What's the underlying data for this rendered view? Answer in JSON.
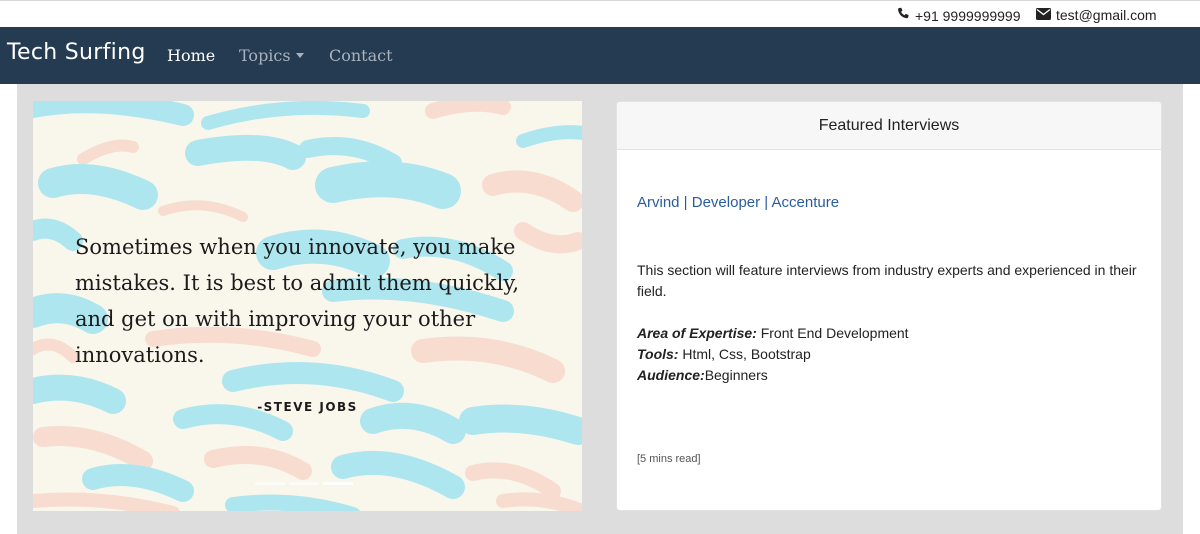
{
  "topbar": {
    "phone_icon": "phone-icon",
    "phone": "+91 9999999999",
    "email_icon": "envelope-icon",
    "email": "test@gmail.com"
  },
  "navbar": {
    "brand": "Tech Surfing",
    "links": [
      {
        "label": "Home",
        "active": true
      },
      {
        "label": "Topics",
        "dropdown": true
      },
      {
        "label": "Contact"
      }
    ]
  },
  "carousel": {
    "quote": "Sometimes when you innovate, you make mistakes. It is best to admit them quickly, and get on with improving your other innovations.",
    "author": "-STEVE JOBS",
    "slide_count": 3,
    "active_slide": 3
  },
  "card": {
    "header": "Featured Interviews",
    "link": "Arvind | Developer | Accenture",
    "description": "This section will feature interviews from industry experts and experienced in their field.",
    "expertise_label": "Area of Expertise:",
    "expertise_value": " Front End Development",
    "tools_label": "Tools:",
    "tools_value": " Html, Css, Bootstrap",
    "audience_label": "Audience:",
    "audience_value": "Beginners",
    "read_time": "[5 mins read]"
  },
  "colors": {
    "navbar_bg": "#243b51",
    "link": "#2a5d9f",
    "brush_blue": "#aee6ef",
    "brush_peach": "#f8dcd0"
  }
}
